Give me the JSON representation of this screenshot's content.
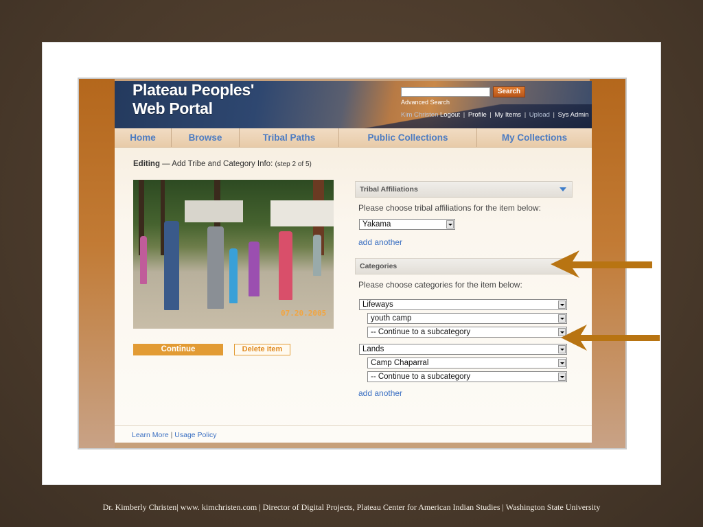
{
  "site": {
    "title_line1": "Plateau Peoples'",
    "title_line2": "Web Portal"
  },
  "search": {
    "value": "",
    "button_label": "Search",
    "advanced_link": "Advanced Search"
  },
  "user_bar": {
    "user_name": "Kim Christen",
    "links": [
      "Logout",
      "Profile",
      "My Items",
      "Upload",
      "Sys Admin"
    ]
  },
  "nav": {
    "items": [
      "Home",
      "Browse",
      "Tribal Paths",
      "Public Collections",
      "My Collections"
    ]
  },
  "editing": {
    "label": "Editing",
    "dash": "—",
    "title": "Add Tribe and Category Info:",
    "step": "(step 2 of 5)"
  },
  "photo": {
    "date_stamp": "07.20.2005"
  },
  "buttons": {
    "continue": "Continue",
    "delete": "Delete item"
  },
  "tribal_affiliations": {
    "header": "Tribal Affiliations",
    "prompt": "Please choose tribal affiliations for the item below:",
    "selected": "Yakama",
    "add_another": "add another"
  },
  "categories": {
    "header": "Categories",
    "prompt": "Please choose categories for the item below:",
    "groups": [
      {
        "category": "Lifeways",
        "sub": "youth camp",
        "subcategory": "-- Continue to a subcategory"
      },
      {
        "category": "Lands",
        "sub": "Camp Chaparral",
        "subcategory": "-- Continue to a subcategory"
      }
    ],
    "add_another": "add another"
  },
  "footer": {
    "learn_more": "Learn More",
    "separator": "|",
    "usage_policy": "Usage Policy"
  },
  "slide_caption": "Dr. Kimberly Christen| www. kimchristen.com | Director of Digital Projects, Plateau Center for American Indian Studies  | Washington State University",
  "colors": {
    "accent_orange": "#e29b34",
    "nav_link_blue": "#4b7bc2",
    "arrow_brown": "#b87412"
  }
}
